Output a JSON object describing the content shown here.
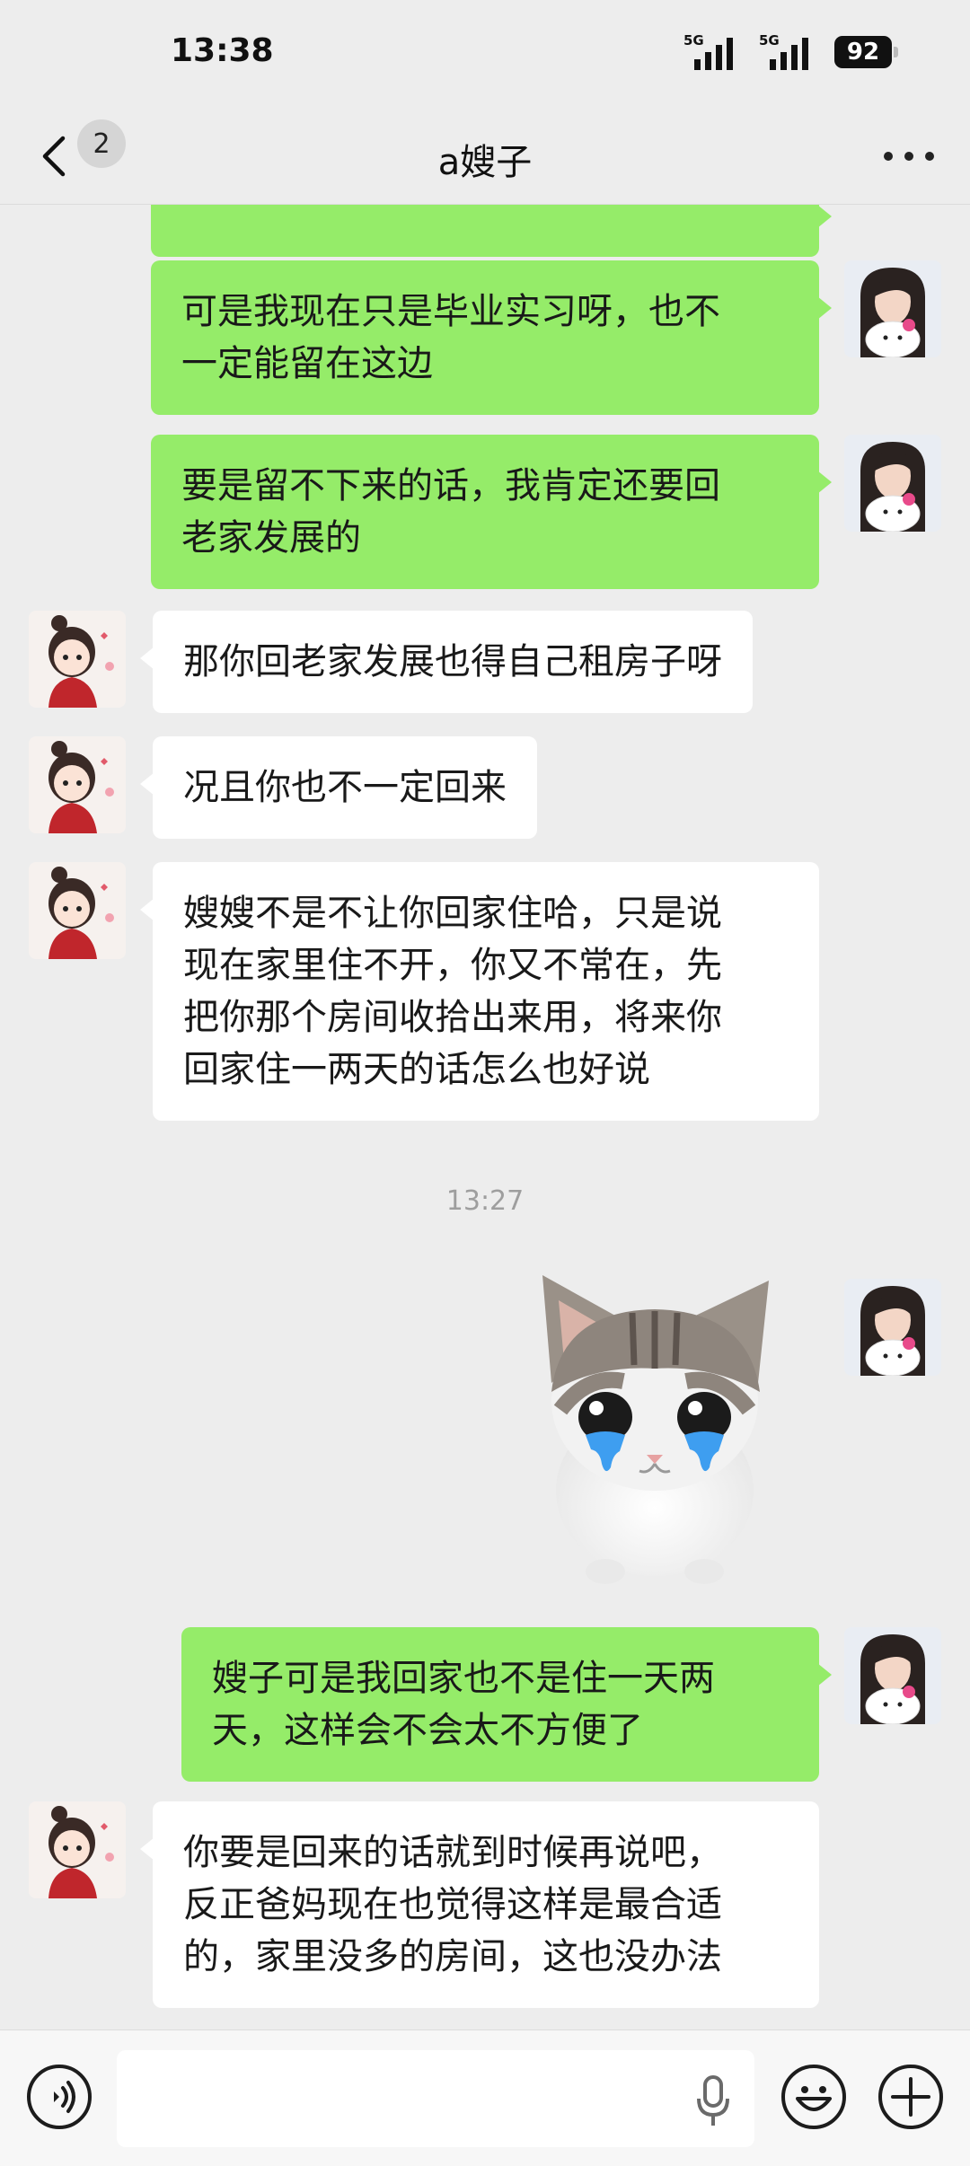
{
  "status": {
    "time": "13:38",
    "network_1": "5G",
    "network_2": "5G",
    "battery": "92"
  },
  "header": {
    "unread_count": "2",
    "title": "a嫂子"
  },
  "messages": [
    {
      "from": "me",
      "text": "可是我现在只是毕业实习呀，也不\n一定能留在这边"
    },
    {
      "from": "me",
      "text": "要是留不下来的话，我肯定还要回\n老家发展的"
    },
    {
      "from": "other",
      "text": "那你回老家发展也得自己租房子呀"
    },
    {
      "from": "other",
      "text": "况且你也不一定回来"
    },
    {
      "from": "other",
      "text": "嫂嫂不是不让你回家住哈，只是说\n现在家里住不开，你又不常在，先\n把你那个房间收拾出来用，将来你\n回家住一两天的话怎么也好说"
    },
    {
      "from": "me",
      "text": "嫂子可是我回家也不是住一天两\n天，这样会不会太不方便了"
    },
    {
      "from": "other",
      "text": "你要是回来的话就到时候再说吧，\n反正爸妈现在也觉得这样是最合适\n的，家里没多的房间，这也没办法"
    }
  ],
  "timestamp": "13:27",
  "sticker": {
    "name": "crying-cat-sticker"
  },
  "colors": {
    "background": "#ededed",
    "my_bubble": "#95ec69",
    "other_bubble": "#ffffff",
    "timestamp_text": "#9e9e9e"
  },
  "input": {
    "value": ""
  }
}
